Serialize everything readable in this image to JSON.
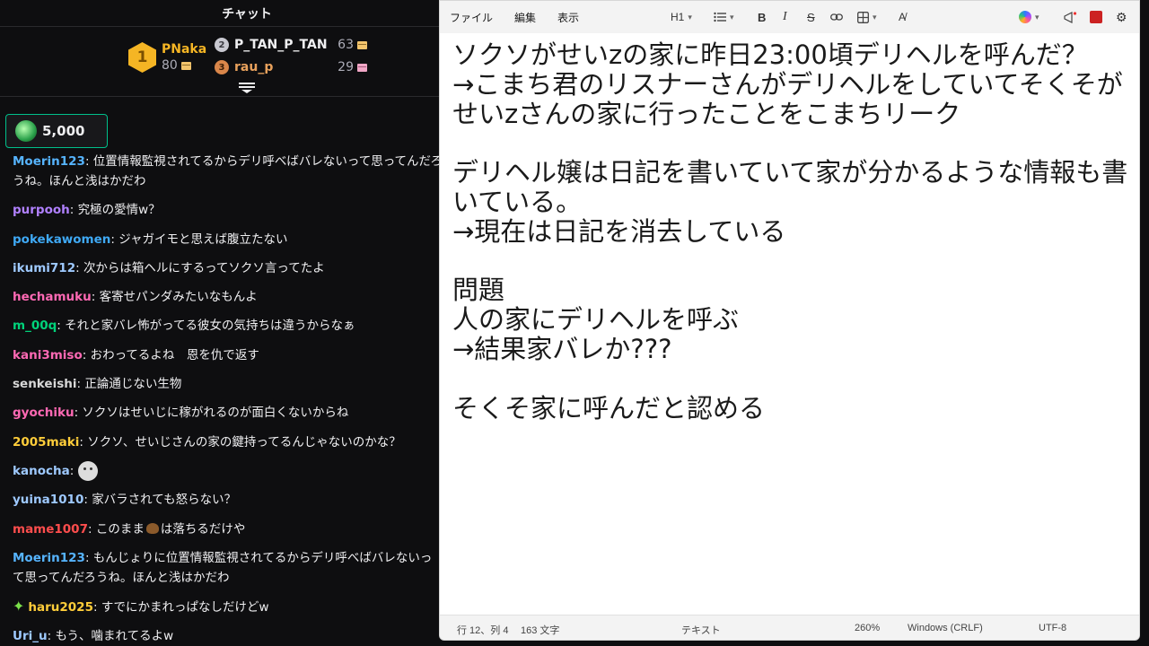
{
  "chat": {
    "title": "チャット",
    "leaderboard": {
      "first": {
        "rank": "1",
        "name": "PNaka",
        "points": "80"
      },
      "second": {
        "rank": "2",
        "name": "P_TAN_P_TAN",
        "points": "63"
      },
      "third": {
        "rank": "3",
        "name": "rau_p",
        "points": "29"
      }
    },
    "channel_points": "5,000",
    "messages": [
      {
        "user": "Moerin123",
        "text": "位置情報監視されてるからデリ呼べばバレないって思ってんだろうね。ほんと浅はかだわ"
      },
      {
        "user": "purpooh",
        "text": "究極の愛情w？"
      },
      {
        "user": "pokekawomen",
        "text": "ジャガイモと思えば腹立たない"
      },
      {
        "user": "ikumi712",
        "text": "次からは箱ヘルにするってソクソ言ってたよ"
      },
      {
        "user": "hechamuku",
        "text": "客寄せパンダみたいなもんよ"
      },
      {
        "user": "m_00q",
        "text": "それと家バレ怖がってる彼女の気持ちは違うからなぁ"
      },
      {
        "user": "kani3miso",
        "text": "おわってるよね　恩を仇で返す"
      },
      {
        "user": "senkeishi",
        "text": "正論通じない生物"
      },
      {
        "user": "gyochiku",
        "text": "ソクソはせいじに稼がれるのが面白くないからね"
      },
      {
        "user": "2005maki",
        "text": "ソクソ、せいじさんの家の鍵持ってるんじゃないのかな？"
      },
      {
        "user": "kanocha",
        "text": ""
      },
      {
        "user": "yuina1010",
        "text": "家バラされても怒らない？"
      },
      {
        "user": "mame1007",
        "text_before": "このまま",
        "text_after": "は落ちるだけや"
      },
      {
        "user": "Moerin123",
        "text": "もんじょりに位置情報監視されてるからデリ呼べばバレないって思ってんだろうね。ほんと浅はかだわ"
      },
      {
        "user": "haru2025",
        "text": "すでにかまれっぱなしだけどw"
      },
      {
        "user": "Uri_u",
        "text": "もう、噛まれてるよw"
      }
    ]
  },
  "notepad": {
    "menu": {
      "file": "ファイル",
      "edit": "編集",
      "view": "表示"
    },
    "toolbar": {
      "heading": "H1"
    },
    "content": "ソクソがせいzの家に昨日23:00頃デリヘルを呼んだ？\n→こまち君のリスナーさんがデリヘルをしていてそくそがせいzさんの家に行ったことをこまちリーク\n\nデリヘル嬢は日記を書いていて家が分かるような情報も書いている。\n→現在は日記を消去している\n\n問題\n人の家にデリヘルを呼ぶ\n→結果家バレか???\n\nそくそ家に呼んだと認める",
    "status": {
      "position": "行 12、列 4",
      "chars": "163 文字",
      "format": "テキスト",
      "zoom": "260%",
      "line_ending": "Windows (CRLF)",
      "encoding": "UTF-8"
    }
  }
}
